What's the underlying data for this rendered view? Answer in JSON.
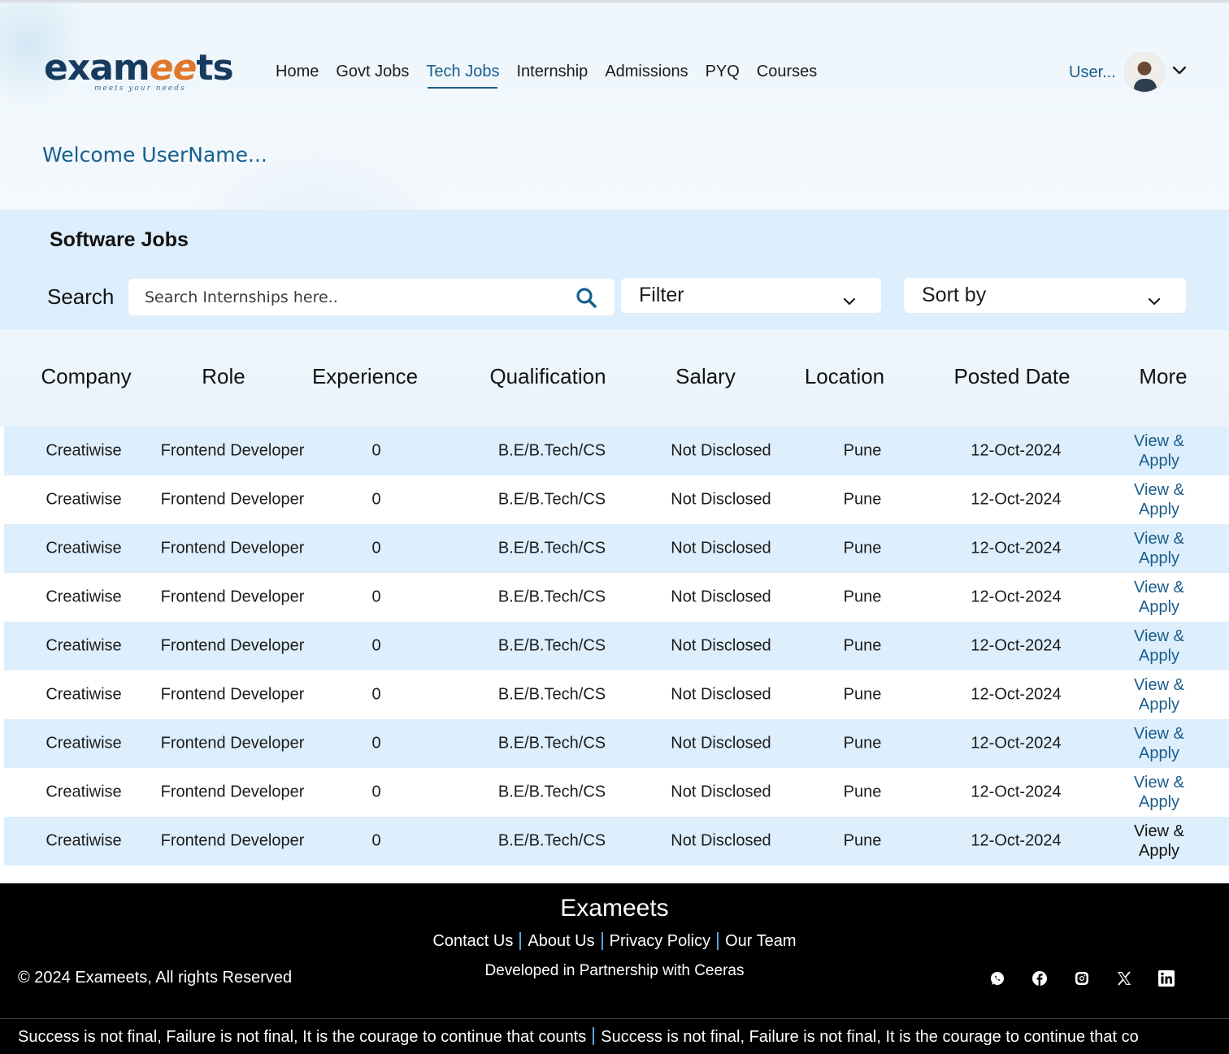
{
  "logo": {
    "part1": "exam",
    "part2": "ee",
    "part3": "ts",
    "tagline": "meets your needs"
  },
  "nav": {
    "items": [
      {
        "label": "Home"
      },
      {
        "label": "Govt Jobs"
      },
      {
        "label": "Tech Jobs",
        "active": true
      },
      {
        "label": "Internship"
      },
      {
        "label": "Admissions"
      },
      {
        "label": "PYQ"
      },
      {
        "label": "Courses"
      }
    ]
  },
  "user": {
    "name": "User..."
  },
  "welcome": "Welcome UserName...",
  "section": {
    "title": "Software Jobs"
  },
  "search": {
    "label": "Search",
    "placeholder": "Search Internships here.."
  },
  "filter": {
    "label": "Filter"
  },
  "sort": {
    "label": "Sort by"
  },
  "table": {
    "headers": [
      "Company",
      "Role",
      "Experience",
      "Qualification",
      "Salary",
      "Location",
      "Posted Date",
      "More"
    ],
    "rows": [
      {
        "company": "Creatiwise",
        "role": "Frontend Developer",
        "experience": "0",
        "qualification": "B.E/B.Tech/CS",
        "salary": "Not Disclosed",
        "location": "Pune",
        "posted": "12-Oct-2024",
        "more": "View & Apply"
      },
      {
        "company": "Creatiwise",
        "role": "Frontend Developer",
        "experience": "0",
        "qualification": "B.E/B.Tech/CS",
        "salary": "Not Disclosed",
        "location": "Pune",
        "posted": "12-Oct-2024",
        "more": "View & Apply"
      },
      {
        "company": "Creatiwise",
        "role": "Frontend Developer",
        "experience": "0",
        "qualification": "B.E/B.Tech/CS",
        "salary": "Not Disclosed",
        "location": "Pune",
        "posted": "12-Oct-2024",
        "more": "View & Apply"
      },
      {
        "company": "Creatiwise",
        "role": "Frontend Developer",
        "experience": "0",
        "qualification": "B.E/B.Tech/CS",
        "salary": "Not Disclosed",
        "location": "Pune",
        "posted": "12-Oct-2024",
        "more": "View & Apply"
      },
      {
        "company": "Creatiwise",
        "role": "Frontend Developer",
        "experience": "0",
        "qualification": "B.E/B.Tech/CS",
        "salary": "Not Disclosed",
        "location": "Pune",
        "posted": "12-Oct-2024",
        "more": "View & Apply"
      },
      {
        "company": "Creatiwise",
        "role": "Frontend Developer",
        "experience": "0",
        "qualification": "B.E/B.Tech/CS",
        "salary": "Not Disclosed",
        "location": "Pune",
        "posted": "12-Oct-2024",
        "more": "View & Apply"
      },
      {
        "company": "Creatiwise",
        "role": "Frontend Developer",
        "experience": "0",
        "qualification": "B.E/B.Tech/CS",
        "salary": "Not Disclosed",
        "location": "Pune",
        "posted": "12-Oct-2024",
        "more": "View & Apply"
      },
      {
        "company": "Creatiwise",
        "role": "Frontend Developer",
        "experience": "0",
        "qualification": "B.E/B.Tech/CS",
        "salary": "Not Disclosed",
        "location": "Pune",
        "posted": "12-Oct-2024",
        "more": "View & Apply"
      },
      {
        "company": "Creatiwise",
        "role": "Frontend Developer",
        "experience": "0",
        "qualification": "B.E/B.Tech/CS",
        "salary": "Not Disclosed",
        "location": "Pune",
        "posted": "12-Oct-2024",
        "more": "View & Apply"
      }
    ]
  },
  "footer": {
    "brand": "Exameets",
    "links": [
      "Contact Us",
      "About Us",
      "Privacy Policy",
      "Our Team"
    ],
    "developed": "Developed in Partnership with Ceeras",
    "copyright": "© 2024 Exameets, All rights Reserved",
    "socials": [
      "whatsapp-icon",
      "facebook-icon",
      "instagram-icon",
      "x-icon",
      "linkedin-icon"
    ]
  },
  "ticker": {
    "text1": "Success is not final, Failure is not final, It is the courage to continue that counts",
    "text2": "Success is not final, Failure is not final, It is the courage to continue that co"
  },
  "colors": {
    "accent": "#1a5d8c",
    "band": "#ddeefc",
    "logo_dark": "#173b5e",
    "logo_orange": "#e0782b",
    "footer_bg": "#000000"
  }
}
